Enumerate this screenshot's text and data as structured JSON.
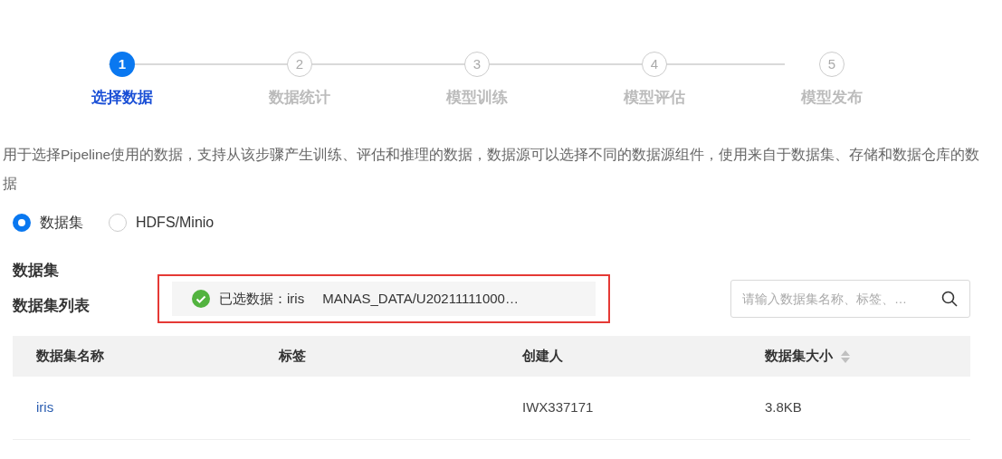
{
  "steps": [
    {
      "number": "1",
      "label": "选择数据",
      "selected": true
    },
    {
      "number": "2",
      "label": "数据统计",
      "selected": false
    },
    {
      "number": "3",
      "label": "模型训练",
      "selected": false
    },
    {
      "number": "4",
      "label": "模型评估",
      "selected": false
    },
    {
      "number": "5",
      "label": "模型发布",
      "selected": false
    }
  ],
  "description": "用于选择Pipeline使用的数据，支持从该步骤产生训练、评估和推理的数据，数据源可以选择不同的数据源组件，使用来自于数据集、存储和数据仓库的数据",
  "source_options": [
    {
      "label": "数据集",
      "selected": true
    },
    {
      "label": "HDFS/Minio",
      "selected": false
    }
  ],
  "section_title": "数据集",
  "list_title": "数据集列表",
  "selection": {
    "label": "已选数据：iris",
    "path": "MANAS_DATA/U20211111000…"
  },
  "search": {
    "placeholder": "请输入数据集名称、标签、…"
  },
  "table": {
    "columns": [
      {
        "label": "数据集名称",
        "sortable": false
      },
      {
        "label": "标签",
        "sortable": false
      },
      {
        "label": "创建人",
        "sortable": false
      },
      {
        "label": "数据集大小",
        "sortable": true
      }
    ],
    "rows": [
      {
        "cells": [
          "iris",
          "",
          "IWX337171",
          "3.8KB"
        ]
      }
    ]
  }
}
